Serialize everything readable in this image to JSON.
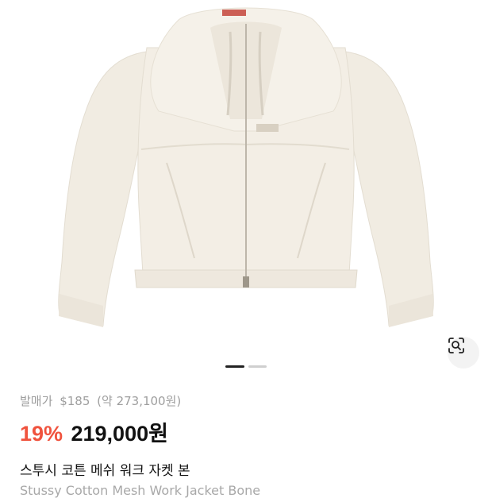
{
  "price": {
    "release_label": "발매가",
    "release_price": "$185",
    "release_price_krw": "(약 273,100원)",
    "discount": "19%",
    "sale_price": "219,000원"
  },
  "product": {
    "title_ko": "스투시 코튼 메쉬 워크 자켓 본",
    "title_en": "Stussy Cotton Mesh Work Jacket Bone"
  },
  "gallery": {
    "image_count": 2,
    "current_index": 1
  },
  "icons": {
    "lens": "lens-search-icon"
  },
  "colors": {
    "discount": "#f0533e",
    "jacket": "#f2ede4"
  }
}
